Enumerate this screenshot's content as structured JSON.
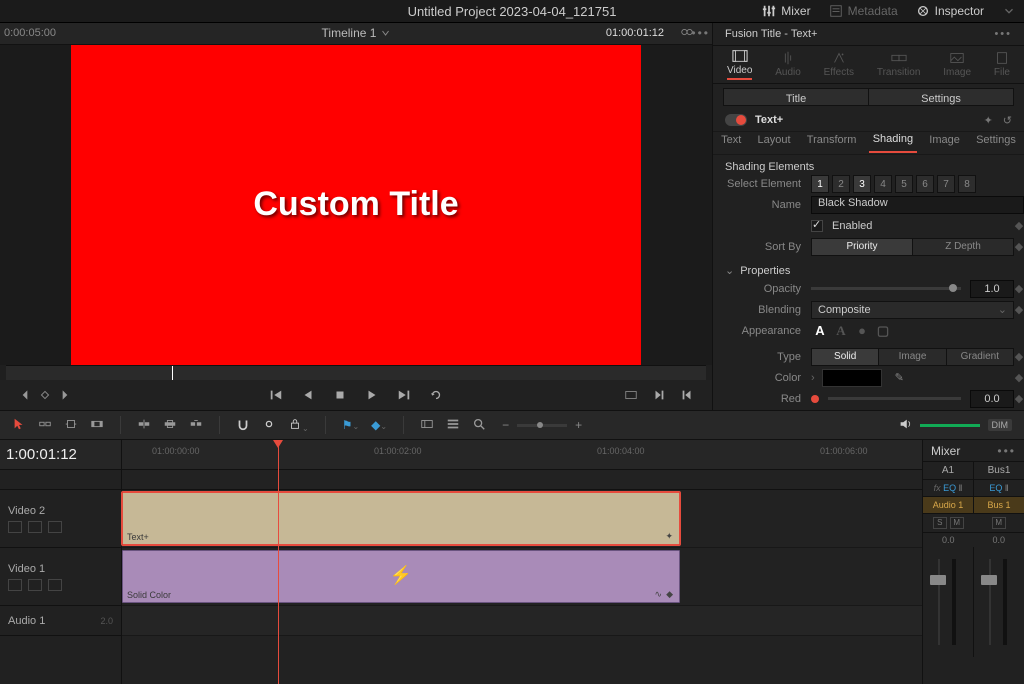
{
  "project_title": "Untitled Project 2023-04-04_121751",
  "topbar": {
    "mixer": "Mixer",
    "metadata": "Metadata",
    "inspector": "Inspector"
  },
  "viewer": {
    "tc_left": "0:00:05:00",
    "timeline_name": "Timeline 1",
    "tc_right": "01:00:01:12",
    "title_text": "Custom Title"
  },
  "inspector": {
    "head": "Fusion Title - Text+",
    "tabs": {
      "video": "Video",
      "audio": "Audio",
      "effects": "Effects",
      "transition": "Transition",
      "image": "Image",
      "file": "File"
    },
    "subtabs": {
      "title": "Title",
      "settings": "Settings"
    },
    "plugin": "Text+",
    "proptabs": {
      "text": "Text",
      "layout": "Layout",
      "transform": "Transform",
      "shading": "Shading",
      "image": "Image",
      "settings": "Settings"
    },
    "shading_elements": "Shading Elements",
    "select_element": "Select Element",
    "elements": [
      "1",
      "2",
      "3",
      "4",
      "5",
      "6",
      "7",
      "8"
    ],
    "name_label": "Name",
    "name_value": "Black Shadow",
    "enabled_label": "Enabled",
    "sortby_label": "Sort By",
    "sortby_priority": "Priority",
    "sortby_zdepth": "Z Depth",
    "properties": "Properties",
    "opacity_label": "Opacity",
    "opacity_value": "1.0",
    "blending_label": "Blending",
    "blending_value": "Composite",
    "appearance_label": "Appearance",
    "type_label": "Type",
    "type_solid": "Solid",
    "type_image": "Image",
    "type_gradient": "Gradient",
    "color_label": "Color",
    "red_label": "Red",
    "red_value": "0.0"
  },
  "toolbar_dim": "DIM",
  "ruler": {
    "t0": "01:00:00:00",
    "t1": "01:00:02:00",
    "t2": "01:00:04:00",
    "t3": "01:00:06:00"
  },
  "tracks": {
    "tc": "1:00:01:12",
    "v2": "Video 2",
    "v1": "Video 1",
    "a1": "Audio 1",
    "a1_val": "2.0",
    "clip_text": "Text+",
    "clip_solid": "Solid Color"
  },
  "mixer": {
    "title": "Mixer",
    "a1": "A1",
    "bus1": "Bus1",
    "eq": "EQ",
    "fx": "fx",
    "audio1": "Audio 1",
    "bus1b": "Bus 1",
    "s": "S",
    "m": "M",
    "zero": "0.0"
  }
}
